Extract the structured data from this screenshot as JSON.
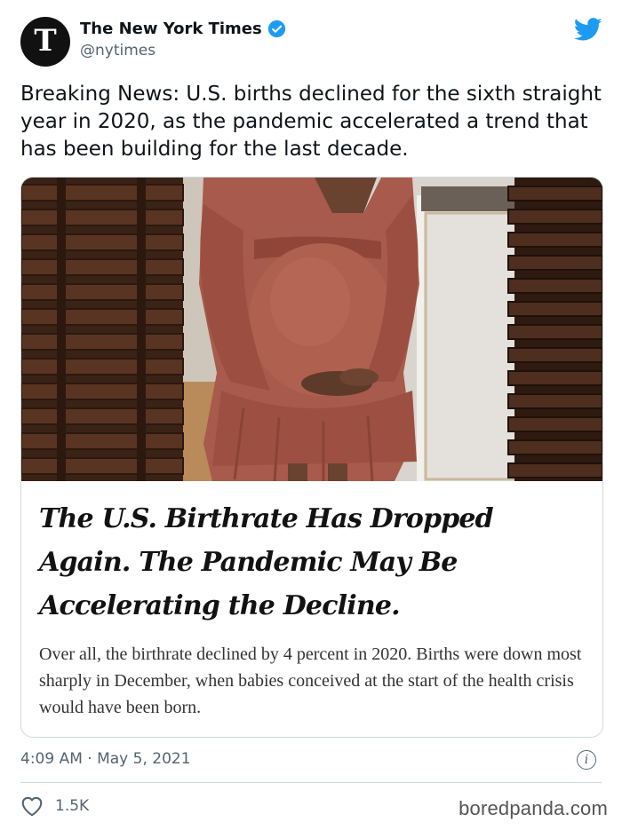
{
  "account": {
    "display_name": "The New York Times",
    "handle": "@nytimes",
    "avatar_letter": "T",
    "verified": true
  },
  "tweet": {
    "text": "Breaking News: U.S. births declined for the sixth straight year in 2020, as the pandemic accelerated a trend that has been building for the last decade."
  },
  "card": {
    "headline": "The U.S. Birthrate Has Dropped Again. The Pandemic May Be Accelerating the Decline.",
    "summary": "Over all, the birthrate declined by 4 percent in 2020. Births were down most sharply in December, when babies conceived at the start of the health crisis would have been born."
  },
  "footer": {
    "timestamp": "4:09 AM · May 5, 2021",
    "likes": "1.5K",
    "info_symbol": "i"
  },
  "watermark": "boredpanda.com",
  "colors": {
    "twitter_blue": "#1d9bf0",
    "muted_text": "#536471",
    "dress": "#a85a4c",
    "wood": "#4a2b1c"
  },
  "icons": {
    "bird": "twitter-bird-icon",
    "verified": "verified-badge-icon",
    "heart": "heart-outline-icon",
    "info": "info-icon"
  }
}
